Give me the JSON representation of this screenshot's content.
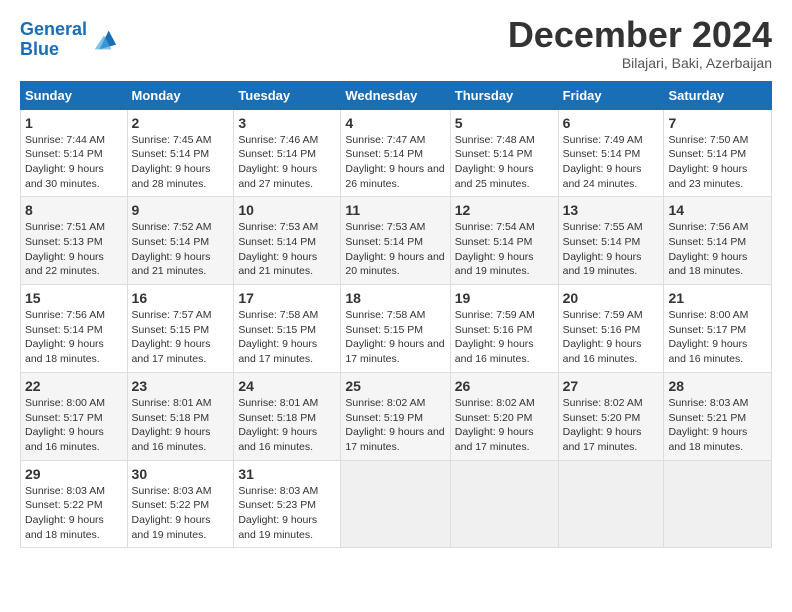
{
  "header": {
    "logo_line1": "General",
    "logo_line2": "Blue",
    "month_title": "December 2024",
    "subtitle": "Bilajari, Baki, Azerbaijan"
  },
  "days_of_week": [
    "Sunday",
    "Monday",
    "Tuesday",
    "Wednesday",
    "Thursday",
    "Friday",
    "Saturday"
  ],
  "weeks": [
    [
      {
        "day": "1",
        "sunrise": "7:44 AM",
        "sunset": "5:14 PM",
        "daylight": "9 hours and 30 minutes."
      },
      {
        "day": "2",
        "sunrise": "7:45 AM",
        "sunset": "5:14 PM",
        "daylight": "9 hours and 28 minutes."
      },
      {
        "day": "3",
        "sunrise": "7:46 AM",
        "sunset": "5:14 PM",
        "daylight": "9 hours and 27 minutes."
      },
      {
        "day": "4",
        "sunrise": "7:47 AM",
        "sunset": "5:14 PM",
        "daylight": "9 hours and 26 minutes."
      },
      {
        "day": "5",
        "sunrise": "7:48 AM",
        "sunset": "5:14 PM",
        "daylight": "9 hours and 25 minutes."
      },
      {
        "day": "6",
        "sunrise": "7:49 AM",
        "sunset": "5:14 PM",
        "daylight": "9 hours and 24 minutes."
      },
      {
        "day": "7",
        "sunrise": "7:50 AM",
        "sunset": "5:14 PM",
        "daylight": "9 hours and 23 minutes."
      }
    ],
    [
      {
        "day": "8",
        "sunrise": "7:51 AM",
        "sunset": "5:13 PM",
        "daylight": "9 hours and 22 minutes."
      },
      {
        "day": "9",
        "sunrise": "7:52 AM",
        "sunset": "5:14 PM",
        "daylight": "9 hours and 21 minutes."
      },
      {
        "day": "10",
        "sunrise": "7:53 AM",
        "sunset": "5:14 PM",
        "daylight": "9 hours and 21 minutes."
      },
      {
        "day": "11",
        "sunrise": "7:53 AM",
        "sunset": "5:14 PM",
        "daylight": "9 hours and 20 minutes."
      },
      {
        "day": "12",
        "sunrise": "7:54 AM",
        "sunset": "5:14 PM",
        "daylight": "9 hours and 19 minutes."
      },
      {
        "day": "13",
        "sunrise": "7:55 AM",
        "sunset": "5:14 PM",
        "daylight": "9 hours and 19 minutes."
      },
      {
        "day": "14",
        "sunrise": "7:56 AM",
        "sunset": "5:14 PM",
        "daylight": "9 hours and 18 minutes."
      }
    ],
    [
      {
        "day": "15",
        "sunrise": "7:56 AM",
        "sunset": "5:14 PM",
        "daylight": "9 hours and 18 minutes."
      },
      {
        "day": "16",
        "sunrise": "7:57 AM",
        "sunset": "5:15 PM",
        "daylight": "9 hours and 17 minutes."
      },
      {
        "day": "17",
        "sunrise": "7:58 AM",
        "sunset": "5:15 PM",
        "daylight": "9 hours and 17 minutes."
      },
      {
        "day": "18",
        "sunrise": "7:58 AM",
        "sunset": "5:15 PM",
        "daylight": "9 hours and 17 minutes."
      },
      {
        "day": "19",
        "sunrise": "7:59 AM",
        "sunset": "5:16 PM",
        "daylight": "9 hours and 16 minutes."
      },
      {
        "day": "20",
        "sunrise": "7:59 AM",
        "sunset": "5:16 PM",
        "daylight": "9 hours and 16 minutes."
      },
      {
        "day": "21",
        "sunrise": "8:00 AM",
        "sunset": "5:17 PM",
        "daylight": "9 hours and 16 minutes."
      }
    ],
    [
      {
        "day": "22",
        "sunrise": "8:00 AM",
        "sunset": "5:17 PM",
        "daylight": "9 hours and 16 minutes."
      },
      {
        "day": "23",
        "sunrise": "8:01 AM",
        "sunset": "5:18 PM",
        "daylight": "9 hours and 16 minutes."
      },
      {
        "day": "24",
        "sunrise": "8:01 AM",
        "sunset": "5:18 PM",
        "daylight": "9 hours and 16 minutes."
      },
      {
        "day": "25",
        "sunrise": "8:02 AM",
        "sunset": "5:19 PM",
        "daylight": "9 hours and 17 minutes."
      },
      {
        "day": "26",
        "sunrise": "8:02 AM",
        "sunset": "5:20 PM",
        "daylight": "9 hours and 17 minutes."
      },
      {
        "day": "27",
        "sunrise": "8:02 AM",
        "sunset": "5:20 PM",
        "daylight": "9 hours and 17 minutes."
      },
      {
        "day": "28",
        "sunrise": "8:03 AM",
        "sunset": "5:21 PM",
        "daylight": "9 hours and 18 minutes."
      }
    ],
    [
      {
        "day": "29",
        "sunrise": "8:03 AM",
        "sunset": "5:22 PM",
        "daylight": "9 hours and 18 minutes."
      },
      {
        "day": "30",
        "sunrise": "8:03 AM",
        "sunset": "5:22 PM",
        "daylight": "9 hours and 19 minutes."
      },
      {
        "day": "31",
        "sunrise": "8:03 AM",
        "sunset": "5:23 PM",
        "daylight": "9 hours and 19 minutes."
      },
      null,
      null,
      null,
      null
    ]
  ],
  "labels": {
    "sunrise": "Sunrise:",
    "sunset": "Sunset:",
    "daylight": "Daylight:"
  }
}
